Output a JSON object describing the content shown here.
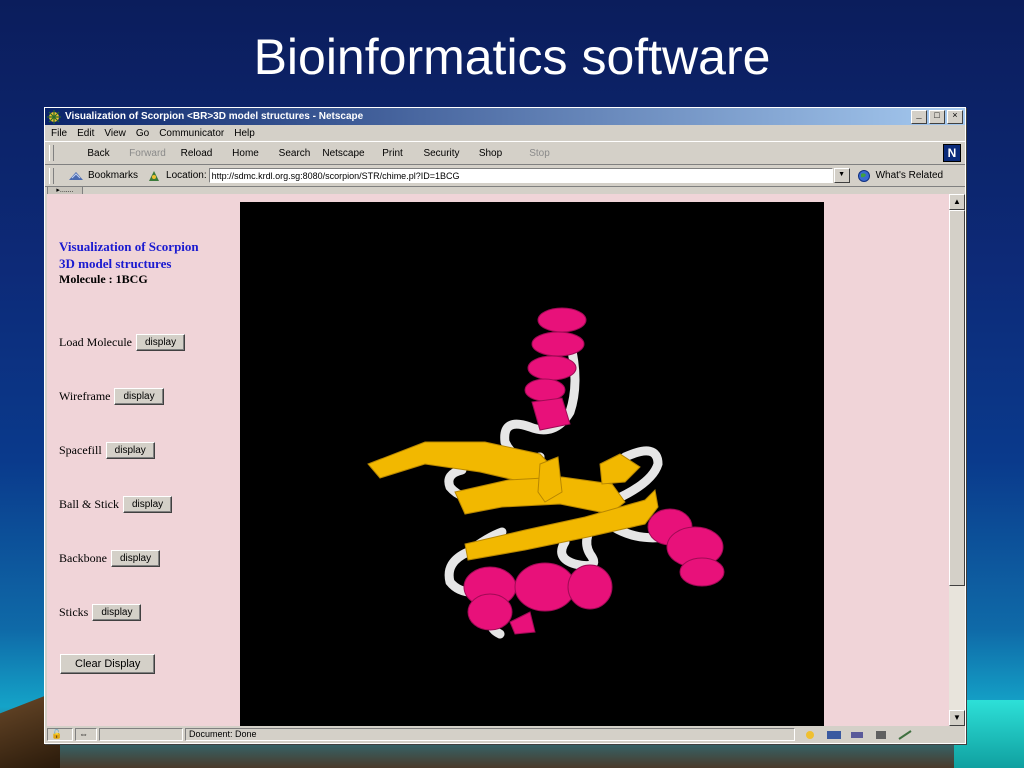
{
  "slide": {
    "title": "Bioinformatics software"
  },
  "window": {
    "title": "Visualization of Scorpion <BR>3D model structures - Netscape",
    "controls": {
      "minimize": "_",
      "maximize": "□",
      "close": "×"
    }
  },
  "menu": [
    "File",
    "Edit",
    "View",
    "Go",
    "Communicator",
    "Help"
  ],
  "toolbar": [
    {
      "label": "Back",
      "enabled": true
    },
    {
      "label": "Forward",
      "enabled": false
    },
    {
      "label": "Reload",
      "enabled": true
    },
    {
      "label": "Home",
      "enabled": true
    },
    {
      "label": "Search",
      "enabled": true
    },
    {
      "label": "Netscape",
      "enabled": true
    },
    {
      "label": "Print",
      "enabled": true
    },
    {
      "label": "Security",
      "enabled": true
    },
    {
      "label": "Shop",
      "enabled": true
    },
    {
      "label": "Stop",
      "enabled": false
    }
  ],
  "toolbar_logo": "N",
  "location": {
    "bookmarks_label": "Bookmarks",
    "location_label": "Location:",
    "url": "http://sdmc.krdl.org.sg:8080/scorpion/STR/chime.pl?ID=1BCG",
    "related_label": "What's Related"
  },
  "page": {
    "heading_line1": "Visualization of Scorpion",
    "heading_line2": "3D model structures",
    "molecule_label": "Molecule : 1BCG",
    "rows": [
      {
        "label": "Load Molecule",
        "button": "display"
      },
      {
        "label": "Wireframe",
        "button": "display"
      },
      {
        "label": "Spacefill",
        "button": "display"
      },
      {
        "label": "Ball & Stick",
        "button": "display"
      },
      {
        "label": "Backbone",
        "button": "display"
      },
      {
        "label": "Sticks",
        "button": "display"
      }
    ],
    "clear_button": "Clear Display"
  },
  "colors": {
    "helix": "#e8117a",
    "strand": "#f2b800",
    "coil": "#e6e6e6",
    "page_bg": "#f0d4d8",
    "heading": "#1a1ad0"
  },
  "status": {
    "text": "Document: Done"
  }
}
